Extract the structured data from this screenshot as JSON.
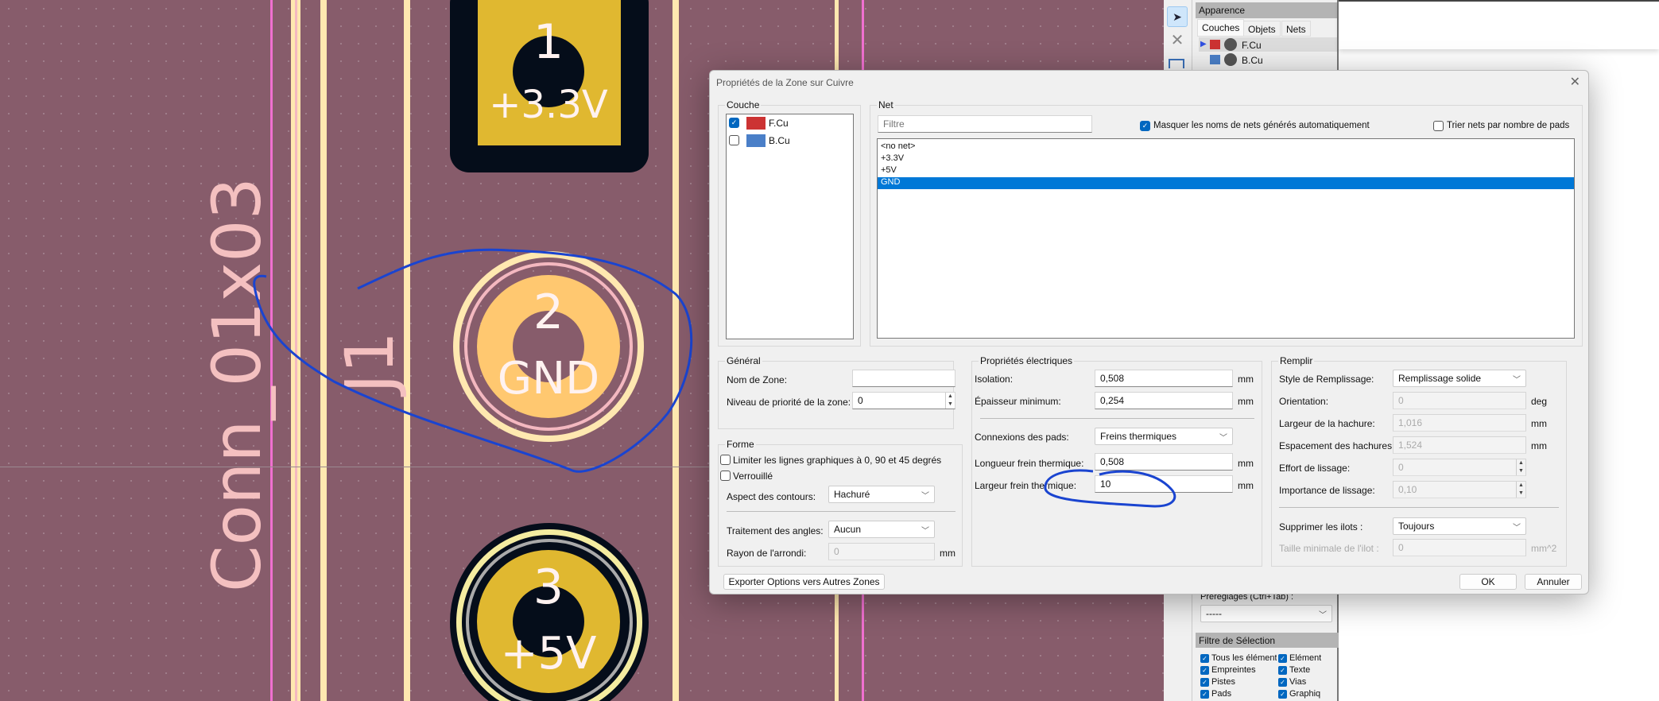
{
  "pcb": {
    "footprint_value": "Conn_01x03",
    "reference": "J1",
    "pads": [
      {
        "number": "1",
        "net": "+3.3V"
      },
      {
        "number": "2",
        "net": "GND"
      },
      {
        "number": "3",
        "net": "+5V"
      }
    ],
    "colors": {
      "board": "#875c6b",
      "copper": "#e0b830",
      "selected_pad": "#ffc870",
      "silk": "#f4c0c0",
      "annotation": "#1a44d0"
    }
  },
  "appearance": {
    "title": "Apparence",
    "tabs": [
      "Couches",
      "Objets",
      "Nets"
    ],
    "layers": [
      {
        "name": "F.Cu",
        "color": "#cc3333"
      },
      {
        "name": "B.Cu",
        "color": "#4a7fc8"
      }
    ],
    "presets_label": "Préréglages (Ctrl+Tab) :",
    "presets_value": "-----",
    "filter_title": "Filtre de Sélection",
    "filter_items": [
      "Tous les éléments",
      "Elément",
      "Empreintes",
      "Texte",
      "Pistes",
      "Vias",
      "Pads",
      "Graphiq"
    ]
  },
  "dialog": {
    "title": "Propriétés de la Zone sur Cuivre",
    "layer_group": "Couche",
    "layers": [
      {
        "name": "F.Cu",
        "checked": true,
        "color": "#cc3333"
      },
      {
        "name": "B.Cu",
        "checked": false,
        "color": "#4a7fc8"
      }
    ],
    "net_group": "Net",
    "filter_placeholder": "Filtre",
    "hide_auto_nets": "Masquer les noms de nets générés automatiquement",
    "sort_nets": "Trier nets par nombre de pads",
    "nets": [
      "<no net>",
      "+3.3V",
      "+5V",
      "GND"
    ],
    "selected_net": "GND",
    "general": {
      "title": "Général",
      "zone_name_label": "Nom de Zone:",
      "zone_name": "",
      "priority_label": "Niveau de priorité de la zone:",
      "priority": "0"
    },
    "shape": {
      "title": "Forme",
      "constrain": "Limiter les lignes graphiques à 0, 90 et 45 degrés",
      "locked": "Verrouillé",
      "outline_label": "Aspect des contours:",
      "outline": "Hachuré",
      "corner_label": "Traitement des angles:",
      "corner": "Aucun",
      "radius_label": "Rayon de l'arrondi:",
      "radius": "0",
      "radius_unit": "mm"
    },
    "electrical": {
      "title": "Propriétés électriques",
      "clearance_label": "Isolation:",
      "clearance": "0,508",
      "min_width_label": "Épaisseur minimum:",
      "min_width": "0,254",
      "pad_conn_label": "Connexions des pads:",
      "pad_conn": "Freins thermiques",
      "relief_gap_label": "Longueur frein thermique:",
      "relief_gap": "0,508",
      "spoke_width_label": "Largeur frein thermique:",
      "spoke_width": "10",
      "unit": "mm"
    },
    "fill": {
      "title": "Remplir",
      "style_label": "Style de Remplissage:",
      "style": "Remplissage solide",
      "orientation_label": "Orientation:",
      "orientation": "0",
      "orientation_unit": "deg",
      "hatch_width_label": "Largeur de la hachure:",
      "hatch_width": "1,016",
      "hatch_gap_label": "Espacement des hachures:",
      "hatch_gap": "1,524",
      "smooth_effort_label": "Effort de lissage:",
      "smooth_effort": "0",
      "smooth_amount_label": "Importance de lissage:",
      "smooth_amount": "0,10",
      "remove_islands_label": "Supprimer les ilots :",
      "remove_islands": "Toujours",
      "min_island_label": "Taille minimale de l'ilot :",
      "min_island": "0",
      "mm": "mm",
      "mm2": "mm^2"
    },
    "export_button": "Exporter Options vers Autres Zones",
    "ok_button": "OK",
    "cancel_button": "Annuler"
  }
}
